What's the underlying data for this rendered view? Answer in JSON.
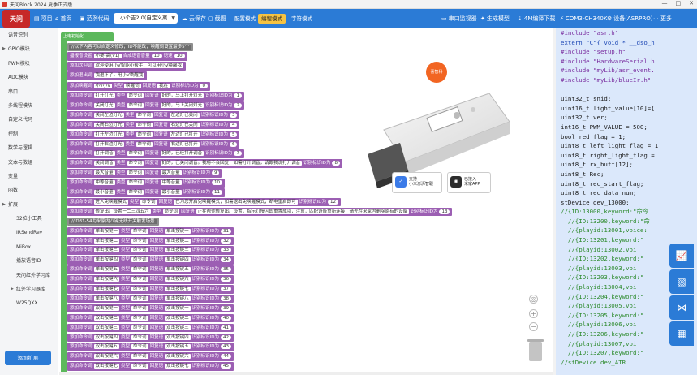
{
  "window": {
    "title": "天问Block 2024 夏季正式版",
    "controls": [
      "—",
      "□",
      "✕"
    ]
  },
  "toolbar": {
    "logo_text": "天问",
    "items_left": [
      {
        "label": "项目",
        "icon": "folder-icon"
      },
      {
        "label": "首页",
        "icon": "home-icon"
      },
      {
        "label": "范例代码",
        "icon": "code-sample-icon"
      }
    ],
    "mode_select": "小个吉2.0(自定义离",
    "items_mid": [
      {
        "label": "云保存",
        "icon": "cloud-save-icon"
      },
      {
        "label": "截图",
        "icon": "screenshot-icon"
      }
    ],
    "tabs": [
      {
        "label": "配置模式",
        "active": false
      },
      {
        "label": "编程模式",
        "active": true
      },
      {
        "label": "字符模式",
        "active": false
      }
    ],
    "items_right": [
      {
        "label": "串口监视器",
        "icon": "monitor-icon"
      },
      {
        "label": "生成模型",
        "icon": "model-icon"
      },
      {
        "label": "4M编译下载",
        "icon": "download-icon"
      },
      {
        "label": "COM3-CH340K",
        "icon": "port-icon"
      },
      {
        "label": "设备(ASRPRO)",
        "icon": "device-icon"
      },
      {
        "label": "更多",
        "icon": "more-icon"
      }
    ],
    "accent": "#2b7bd6",
    "active_tab_color": "#f6c342"
  },
  "sidebar": {
    "categories": [
      {
        "label": "语音识别",
        "sub": false,
        "expand": false
      },
      {
        "label": "GPIO模块",
        "sub": false,
        "expand": true
      },
      {
        "label": "PWM模块",
        "sub": false,
        "expand": false
      },
      {
        "label": "ADC模块",
        "sub": false,
        "expand": false
      },
      {
        "label": "串口",
        "sub": false,
        "expand": false
      },
      {
        "label": "多线程模块",
        "sub": false,
        "expand": false
      },
      {
        "label": "自定义代码",
        "sub": false,
        "expand": false
      },
      {
        "label": "控制",
        "sub": false,
        "expand": false
      },
      {
        "label": "数学与逻辑",
        "sub": false,
        "expand": false
      },
      {
        "label": "文本与数组",
        "sub": false,
        "expand": false
      },
      {
        "label": "变量",
        "sub": false,
        "expand": false
      },
      {
        "label": "函数",
        "sub": false,
        "expand": false
      },
      {
        "label": "扩展",
        "sub": false,
        "expand": true
      },
      {
        "label": "32位小工具",
        "sub": true,
        "expand": false
      },
      {
        "label": "IRSendRev",
        "sub": true,
        "expand": false
      },
      {
        "label": "MiBox",
        "sub": true,
        "expand": false
      },
      {
        "label": "播放语音ID",
        "sub": true,
        "expand": false
      },
      {
        "label": "天问红外学习库",
        "sub": true,
        "expand": false
      },
      {
        "label": "红外学习器库",
        "sub": true,
        "expand": true
      },
      {
        "label": "W25QXX",
        "sub": true,
        "expand": false
      }
    ],
    "add_extension": "添加扩展"
  },
  "workspace": {
    "root_label": "上电初始化",
    "product": {
      "brand": "喜智科",
      "badge1_line1": "支持",
      "badge1_line2": "小米澎湃智联",
      "badge2_line1": "已接入",
      "badge2_line2": "米家APP"
    },
    "rows": [
      {
        "type": "comment",
        "text": "//以下内容可以自定义修改，ID不能改，唤醒词设置最多5个"
      },
      {
        "type": "setup",
        "parts": [
          "播报音设置",
          "小葵-高(V1)",
          "合成语音音量",
          "10",
          "语速",
          "10"
        ]
      },
      {
        "type": "setup",
        "parts": [
          "添加欢迎词",
          "欢迎使用小V智能小帮手，可以用小V唤醒我"
        ]
      },
      {
        "type": "setup",
        "parts": [
          "添加退出词",
          "我退下了，用小V唤醒我"
        ]
      },
      {
        "type": "cmd",
        "parts": [
          "添加唤醒词",
          "小V小V",
          "类型",
          "唤醒词",
          "回复语",
          "我在",
          "识别标识ID为",
          "0"
        ]
      },
      {
        "type": "cmd",
        "parts": [
          "添加命令词",
          "打开灯光",
          "类型",
          "命令词",
          "回复语",
          "好的，马上打开灯光",
          "识别标识ID为",
          "1"
        ]
      },
      {
        "type": "cmd",
        "parts": [
          "添加命令词",
          "关闭灯光",
          "类型",
          "命令词",
          "回复语",
          "好的，马上关闭灯光",
          "识别标识ID为",
          "2"
        ]
      },
      {
        "type": "cmd",
        "parts": [
          "添加命令词",
          "关闭左边灯光",
          "类型",
          "命令词",
          "回复语",
          "左边灯已关闭",
          "识别标识ID为",
          "3"
        ]
      },
      {
        "type": "cmd",
        "parts": [
          "添加命令词",
          "关闭右边灯光",
          "类型",
          "命令词",
          "回复语",
          "右边灯已关闭",
          "识别标识ID为",
          "4"
        ]
      },
      {
        "type": "cmd",
        "parts": [
          "添加命令词",
          "打开左边灯光",
          "类型",
          "命令词",
          "回复语",
          "左边灯已打开",
          "识别标识ID为",
          "5"
        ]
      },
      {
        "type": "cmd",
        "parts": [
          "添加命令词",
          "打开右边灯光",
          "类型",
          "命令词",
          "回复语",
          "右边灯已打开",
          "识别标识ID为",
          "6"
        ]
      },
      {
        "type": "cmd",
        "parts": [
          "添加命令词",
          "打开调音",
          "类型",
          "命令词",
          "回复语",
          "好的，已经打开调音",
          "识别标识ID为",
          "7"
        ]
      },
      {
        "type": "cmd",
        "parts": [
          "添加命令词",
          "关闭调音",
          "类型",
          "命令词",
          "回复语",
          "好的，已关闭调音。我将不会回复，如需打开调音，请跟我说打开调音",
          "识别标识ID为",
          "8"
        ]
      },
      {
        "type": "cmd",
        "parts": [
          "添加命令词",
          "最大音量",
          "类型",
          "命令词",
          "回复语",
          "最大音量",
          "识别标识ID为",
          "9"
        ]
      },
      {
        "type": "cmd",
        "parts": [
          "添加命令词",
          "中等音量",
          "类型",
          "命令词",
          "回复语",
          "中等音量",
          "识别标识ID为",
          "10"
        ]
      },
      {
        "type": "cmd",
        "parts": [
          "添加命令词",
          "最小音量",
          "类型",
          "命令词",
          "回复语",
          "最小音量",
          "识别标识ID为",
          "11"
        ]
      },
      {
        "type": "cmd",
        "parts": [
          "添加命令词",
          "进入免唤醒模式",
          "类型",
          "命令词",
          "回复语",
          "已为您开启免唤醒模式，如需退出免唤醒模式，断电重启即可",
          "识别标识ID为",
          "12"
        ]
      },
      {
        "type": "cmd",
        "parts": [
          "添加命令词",
          "恢复出厂设置一二三四五六",
          "类型",
          "命令词",
          "回复语",
          "正在帮你恢复出厂设置，指示灯慢闪即重置成功，注意，匹配设备重新连接，请先在米家内删除原有的设备",
          "识别标识ID为",
          "13"
        ]
      },
      {
        "type": "comment",
        "text": "//ID31-54为米家内八键无线开关触发场景"
      },
      {
        "type": "cmd",
        "parts": [
          "添加命令词",
          "单击按键一",
          "类型",
          "命令词",
          "回复语",
          "单击按键一",
          "识别标识ID为",
          "31"
        ]
      },
      {
        "type": "cmd",
        "parts": [
          "添加命令词",
          "单击按键二",
          "类型",
          "命令词",
          "回复语",
          "单击按键二",
          "识别标识ID为",
          "32"
        ]
      },
      {
        "type": "cmd",
        "parts": [
          "添加命令词",
          "单击按键三",
          "类型",
          "命令词",
          "回复语",
          "单击按键三",
          "识别标识ID为",
          "33"
        ]
      },
      {
        "type": "cmd",
        "parts": [
          "添加命令词",
          "单击按键四",
          "类型",
          "命令词",
          "回复语",
          "单击按键四",
          "识别标识ID为",
          "34"
        ]
      },
      {
        "type": "cmd",
        "parts": [
          "添加命令词",
          "单击按键五",
          "类型",
          "命令词",
          "回复语",
          "单击按键五",
          "识别标识ID为",
          "35"
        ]
      },
      {
        "type": "cmd",
        "parts": [
          "添加命令词",
          "单击按键六",
          "类型",
          "命令词",
          "回复语",
          "单击按键六",
          "识别标识ID为",
          "36"
        ]
      },
      {
        "type": "cmd",
        "parts": [
          "添加命令词",
          "单击按键七",
          "类型",
          "命令词",
          "回复语",
          "单击按键七",
          "识别标识ID为",
          "37"
        ]
      },
      {
        "type": "cmd",
        "parts": [
          "添加命令词",
          "单击按键八",
          "类型",
          "命令词",
          "回复语",
          "单击按键八",
          "识别标识ID为",
          "38"
        ]
      },
      {
        "type": "cmd",
        "parts": [
          "添加命令词",
          "双击按键一",
          "类型",
          "命令词",
          "回复语",
          "双击按键一",
          "识别标识ID为",
          "39"
        ]
      },
      {
        "type": "cmd",
        "parts": [
          "添加命令词",
          "双击按键二",
          "类型",
          "命令词",
          "回复语",
          "双击按键二",
          "识别标识ID为",
          "40"
        ]
      },
      {
        "type": "cmd",
        "parts": [
          "添加命令词",
          "双击按键三",
          "类型",
          "命令词",
          "回复语",
          "双击按键三",
          "识别标识ID为",
          "41"
        ]
      },
      {
        "type": "cmd",
        "parts": [
          "添加命令词",
          "双击按键四",
          "类型",
          "命令词",
          "回复语",
          "双击按键四",
          "识别标识ID为",
          "42"
        ]
      },
      {
        "type": "cmd",
        "parts": [
          "添加命令词",
          "双击按键五",
          "类型",
          "命令词",
          "回复语",
          "双击按键五",
          "识别标识ID为",
          "43"
        ]
      },
      {
        "type": "cmd",
        "parts": [
          "添加命令词",
          "双击按键六",
          "类型",
          "命令词",
          "回复语",
          "双击按键六",
          "识别标识ID为",
          "44"
        ]
      },
      {
        "type": "cmd",
        "parts": [
          "添加命令词",
          "双击按键七",
          "类型",
          "命令词",
          "回复语",
          "双击按键七",
          "识别标识ID为",
          "45"
        ]
      }
    ]
  },
  "code": {
    "lines": [
      {
        "t": "#include \"asr.h\"",
        "c": "dir"
      },
      {
        "t": "extern \"C\"{ void * __dso_h",
        "c": "kw"
      },
      {
        "t": "#include \"setup.h\"",
        "c": "dir"
      },
      {
        "t": "#include \"HardwareSerial.h",
        "c": "dir"
      },
      {
        "t": "#include \"myLib/asr_event.",
        "c": "dir"
      },
      {
        "t": "#include \"myLib/blueIr.h\"",
        "c": "dir"
      },
      {
        "t": "",
        "c": ""
      },
      {
        "t": "uint32_t snid;",
        "c": ""
      },
      {
        "t": "uint16_t light_value[10]={",
        "c": ""
      },
      {
        "t": "uint32_t ver;",
        "c": ""
      },
      {
        "t": "int16_t PWM_VALUE = 500;",
        "c": ""
      },
      {
        "t": "bool red_flag = 1;",
        "c": ""
      },
      {
        "t": "uint8_t left_light_flag = 1",
        "c": ""
      },
      {
        "t": "uint8_t right_light_flag =",
        "c": ""
      },
      {
        "t": "uint8_t rx_buff[12];",
        "c": ""
      },
      {
        "t": "uint8_t Rec;",
        "c": ""
      },
      {
        "t": "uint8_t rec_start_flag;",
        "c": ""
      },
      {
        "t": "uint8_t rec_data_num;",
        "c": ""
      },
      {
        "t": "stDevice dev_13000;",
        "c": ""
      },
      {
        "t": "//{ID:13000,keyword:\"命令",
        "c": "cm"
      },
      {
        "t": "  //{ID:13200,keyword:\"命",
        "c": "cm"
      },
      {
        "t": "  //{playid:13001,voice:",
        "c": "cm"
      },
      {
        "t": "  //{ID:13201,keyword:\"",
        "c": "cm"
      },
      {
        "t": "  //{playid:13002,voi",
        "c": "cm"
      },
      {
        "t": "  //{ID:13202,keyword:\"",
        "c": "cm"
      },
      {
        "t": "  //{playid:13003,voi",
        "c": "cm"
      },
      {
        "t": "  //{ID:13203,keyword:\"",
        "c": "cm"
      },
      {
        "t": "  //{playid:13004,voi",
        "c": "cm"
      },
      {
        "t": "  //{ID:13204,keyword:\"",
        "c": "cm"
      },
      {
        "t": "  //{playid:13005,voi",
        "c": "cm"
      },
      {
        "t": "  //{ID:13205,keyword:\"",
        "c": "cm"
      },
      {
        "t": "  //{playid:13006,voi",
        "c": "cm"
      },
      {
        "t": "  //{ID:13206,keyword:\"",
        "c": "cm"
      },
      {
        "t": "  //{playid:13007,voi",
        "c": "cm"
      },
      {
        "t": "  //{ID:13207,keyword:\"",
        "c": "cm"
      },
      {
        "t": "//stDevice dev_ATR",
        "c": "cm"
      }
    ],
    "float_icons": [
      "chart-icon",
      "image-icon",
      "share-icon",
      "grid-icon"
    ]
  }
}
